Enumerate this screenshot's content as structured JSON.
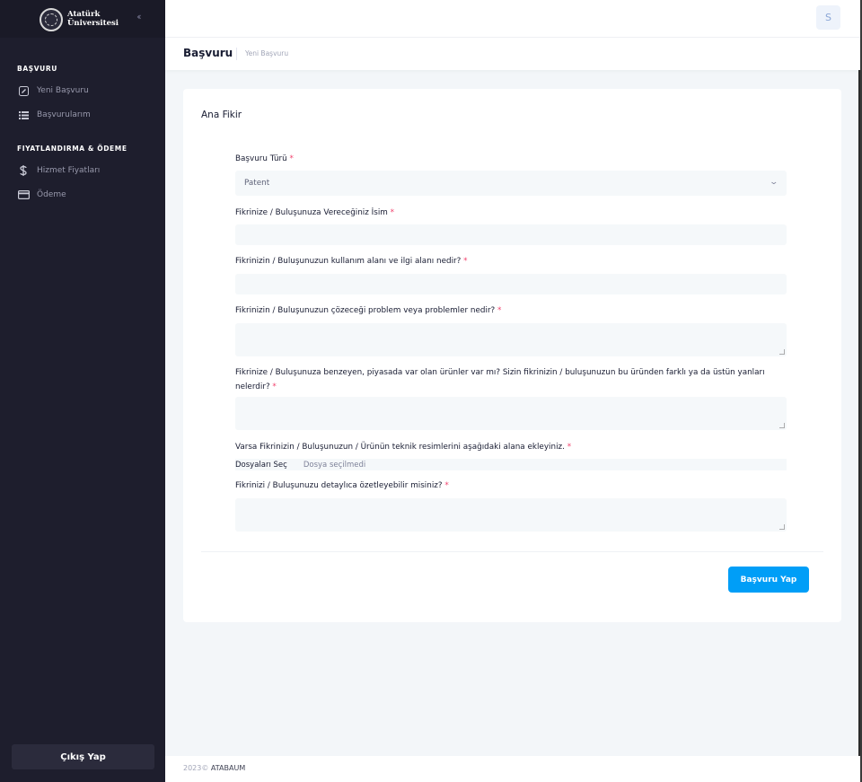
{
  "brand": {
    "line1": "Atatürk",
    "line2": "Üniversitesi"
  },
  "sidebar": {
    "section1": "BAŞVURU",
    "items1": [
      {
        "label": "Yeni Başvuru",
        "icon": "new-doc-icon"
      },
      {
        "label": "Başvurularım",
        "icon": "list-icon"
      }
    ],
    "section2": "FIYATLANDIRMA & ÖDEME",
    "items2": [
      {
        "label": "Hizmet Fiyatları",
        "icon": "price-tag-icon"
      },
      {
        "label": "Ödeme",
        "icon": "credit-card-icon"
      }
    ],
    "logout": "Çıkış Yap"
  },
  "header": {
    "avatar": "S"
  },
  "breadcrumb": {
    "title": "Başvuru",
    "sub": "Yeni Başvuru"
  },
  "card": {
    "title": "Ana Fikir",
    "fields": {
      "type_label": "Başvuru Türü",
      "type_value": "Patent",
      "name_label": "Fikrinize / Buluşunuza Vereceğiniz İsim",
      "usage_label": "Fikrinizin / Buluşunuzun kullanım alanı ve ilgi alanı nedir?",
      "problem_label": "Fikrinizin / Buluşunuzun çözeceği problem veya problemler nedir?",
      "similar_label": "Fikrinize / Buluşunuza benzeyen, piyasada var olan ürünler var mı? Sizin fikrinizin / buluşunuzun bu üründen farklı ya da üstün yanları nelerdir?",
      "images_label": "Varsa Fikrinizin / Buluşunuzun / Ürünün teknik resimlerini aşağıdaki alana ekleyiniz.",
      "file_button": "Dosyaları Seç",
      "file_status": "Dosya seçilmedi",
      "summary_label": "Fikrinizi / Buluşunuzu detaylıca özetleyebilir misiniz?",
      "required_mark": "*"
    },
    "submit": "Başvuru Yap"
  },
  "footer": {
    "year": "2023©",
    "name": "ATABAUM"
  },
  "colors": {
    "accent": "#009ef7",
    "sidebar": "#1e1e2d",
    "required": "#f1416c"
  }
}
